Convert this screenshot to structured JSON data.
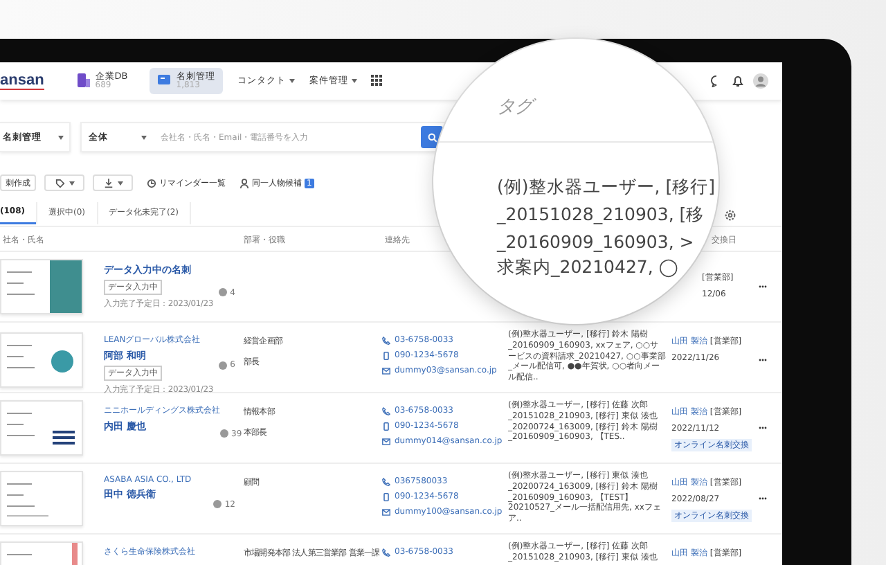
{
  "header": {
    "logo": "ansan",
    "nav": [
      {
        "kind": "app",
        "label": "企業DB",
        "count": "689",
        "selected": false
      },
      {
        "kind": "app",
        "label": "名刺管理",
        "count": "1,813",
        "selected": true
      },
      {
        "kind": "menu",
        "label": "コンタクト"
      },
      {
        "kind": "menu",
        "label": "案件管理"
      }
    ]
  },
  "search": {
    "scope": "名刺管理",
    "filter": "全体",
    "placeholder": "会社名・氏名・Email・電話番号を入力"
  },
  "toolbar": {
    "create": "刺作成",
    "reminders": "リマインダー一覧",
    "duplicates": "同一人物候補",
    "duplicates_count": "1"
  },
  "tabs": [
    {
      "label": "(108)",
      "selected": true
    },
    {
      "label": "選択中(0)",
      "selected": false
    },
    {
      "label": "データ化未完了(2)",
      "selected": false
    }
  ],
  "table": {
    "columns": [
      "社名・氏名",
      "部署・役職",
      "連絡先",
      "交換日"
    ],
    "rows": [
      {
        "kind": "teal",
        "name": "データ入力中の名刺",
        "status": "データ入力中",
        "due": "入力完了予定日：2023/01/23",
        "comments": "4",
        "owner_dept": "[営業部]",
        "date": "12/06"
      },
      {
        "kind": "globe",
        "company": "LEANグローバル株式会社",
        "name": "阿部 和明",
        "status": "データ入力中",
        "due": "入力完了予定日：2023/01/23",
        "comments": "6",
        "dept": "経営企画部",
        "title": "部長",
        "phone": "03-6758-0033",
        "mobile": "090-1234-5678",
        "email": "dummy03@sansan.co.jp",
        "tags": "(例)整水器ユーザー, [移行] 鈴木 陽樹 _20160909_160903, xxフェア, ○○サービスの資料請求_20210427, ○○事業部_メール配信可, ●●年賀状, ○○者向メール配信..",
        "owner": "山田 製治",
        "owner_dept": "[営業部]",
        "date": "2022/11/26"
      },
      {
        "kind": "stripes",
        "company": "ニニホールディングス株式会社",
        "name": "内田 慶也",
        "comments": "39",
        "dept": "情報本部",
        "title": "本部長",
        "phone": "03-6758-0033",
        "mobile": "090-1234-5678",
        "email": "dummy014@sansan.co.jp",
        "tags": "(例)整水器ユーザー, [移行] 佐藤 次郎 _20151028_210903, [移行] 東似 湊也 _20200724_163009, [移行] 鈴木 陽樹 _20160909_160903, 【TES..",
        "owner": "山田 製治",
        "owner_dept": "[営業部]",
        "date": "2022/11/12",
        "badge": "オンライン名刺交換"
      },
      {
        "kind": "plain",
        "company": "ASABA ASIA CO., LTD",
        "name": "田中 徳兵衛",
        "comments": "12",
        "dept": "顧問",
        "phone": "0367580033",
        "mobile": "090-1234-5678",
        "email": "dummy100@sansan.co.jp",
        "tags": "(例)整水器ユーザー, [移行] 東似 湊也 _20200724_163009, [移行] 鈴木 陽樹 _20160909_160903, 【TEST】20210527_メール一括配信用先, xxフェア..",
        "owner": "山田 製治",
        "owner_dept": "[営業部]",
        "date": "2022/08/27",
        "badge": "オンライン名刺交換"
      },
      {
        "kind": "pinkbar",
        "company": "さくら生命保険株式会社",
        "dept": "市場開発本部 法人第三営業部 営業一課",
        "phone": "03-6758-0033",
        "tags": "(例)整水器ユーザー, [移行] 佐藤 次郎 _20151028_210903, [移行] 東似 湊也",
        "owner": "山田 製治",
        "owner_dept": "[営業部]"
      }
    ]
  },
  "magnifier": {
    "heading": "タグ",
    "lines": [
      "(例)整水器ユーザー, [移行]",
      "_20151028_210903, [移",
      "_20160909_160903, >",
      "求案内_20210427, ◯"
    ]
  }
}
